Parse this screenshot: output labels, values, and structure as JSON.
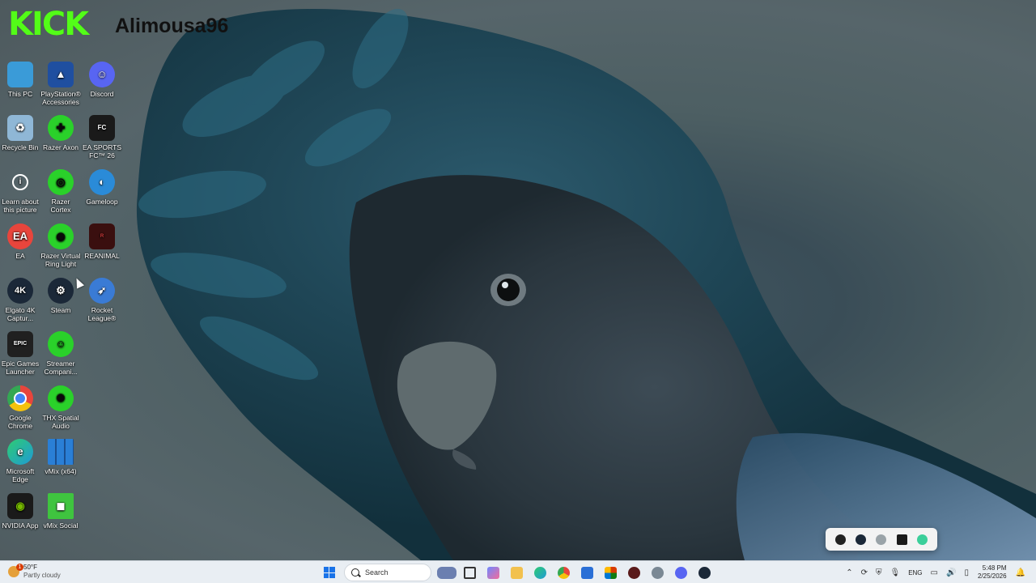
{
  "overlay": {
    "kick_logo": "KICK",
    "channel_name": "Alimousa96"
  },
  "desktop_icons": [
    {
      "label": "This PC",
      "icon": "this-pc-icon",
      "color": "#3a9bd8"
    },
    {
      "label": "PlayStation® Accessories",
      "icon": "playstation-icon",
      "color": "#1f4fa0"
    },
    {
      "label": "Discord",
      "icon": "discord-icon",
      "color": "#5865f2"
    },
    {
      "label": "Recycle Bin",
      "icon": "recycle-bin-icon",
      "color": "#8fb7d6"
    },
    {
      "label": "Razer Axon",
      "icon": "razer-axon-icon",
      "color": "#2ad12a"
    },
    {
      "label": "EA SPORTS FC™ 26",
      "icon": "ea-fc-icon",
      "color": "#1a1a1a"
    },
    {
      "label": "Learn about this picture",
      "icon": "learn-picture-icon",
      "color": "transparent"
    },
    {
      "label": "Razer Cortex",
      "icon": "razer-cortex-icon",
      "color": "#2ad12a"
    },
    {
      "label": "Gameloop",
      "icon": "gameloop-icon",
      "color": "#2a8bd8"
    },
    {
      "label": "EA",
      "icon": "ea-icon",
      "color": "#e8453c"
    },
    {
      "label": "Razer Virtual Ring Light",
      "icon": "razer-ring-light-icon",
      "color": "#2ad12a"
    },
    {
      "label": "REANIMAL",
      "icon": "reanimal-icon",
      "color": "#3a0f0f"
    },
    {
      "label": "Elgato 4K Captur...",
      "icon": "elgato-icon",
      "color": "#1b2838"
    },
    {
      "label": "Steam",
      "icon": "steam-icon",
      "color": "#1b2838"
    },
    {
      "label": "Rocket League®",
      "icon": "rocket-league-icon",
      "color": "#3a7bd5"
    },
    {
      "label": "Epic Games Launcher",
      "icon": "epic-games-icon",
      "color": "#202020"
    },
    {
      "label": "Streamer Compani...",
      "icon": "streamer-companion-icon",
      "color": "#2ad12a"
    },
    {
      "label": "Google Chrome",
      "icon": "chrome-icon",
      "color": "#e8453c"
    },
    {
      "label": "THX Spatial Audio",
      "icon": "thx-spatial-icon",
      "color": "#2ad12a"
    },
    {
      "label": "Microsoft Edge",
      "icon": "edge-icon",
      "color": "#1f9ad6"
    },
    {
      "label": "vMix (x64)",
      "icon": "vmix-icon",
      "color": "#2a7fd6"
    },
    {
      "label": "NVIDIA App",
      "icon": "nvidia-icon",
      "color": "#1a1a1a"
    },
    {
      "label": "vMix Social",
      "icon": "vmix-social-icon",
      "color": "#3fc43f"
    }
  ],
  "taskbar": {
    "weather": {
      "temp": "50°F",
      "condition": "Partly cloudy",
      "badge": "1"
    },
    "search_placeholder": "Search",
    "pinned": [
      {
        "name": "start-button",
        "color": "#1a73e8"
      },
      {
        "name": "widget-app",
        "color": "#6b7fb0"
      },
      {
        "name": "task-view",
        "color": "#333333"
      },
      {
        "name": "copilot",
        "color": "#6f88ff"
      },
      {
        "name": "file-explorer",
        "color": "#f2c14e"
      },
      {
        "name": "edge",
        "color": "#1f9ad6"
      },
      {
        "name": "chrome",
        "color": "#e8453c"
      },
      {
        "name": "store",
        "color": "#2a6fd6"
      },
      {
        "name": "office-app",
        "color": "#d83b01"
      },
      {
        "name": "reanimal-app",
        "color": "#5a1a1a"
      },
      {
        "name": "settings",
        "color": "#7a8894"
      },
      {
        "name": "discord",
        "color": "#5865f2"
      },
      {
        "name": "steam",
        "color": "#1b2838"
      }
    ],
    "tray": {
      "language": "ENG",
      "time": "5:48 PM",
      "date": "2/25/2026"
    }
  },
  "tray_popup": [
    "obs-tray-icon",
    "steam-tray-icon",
    "record-tray-icon",
    "nvidia-tray-icon",
    "gameloop-tray-icon"
  ]
}
